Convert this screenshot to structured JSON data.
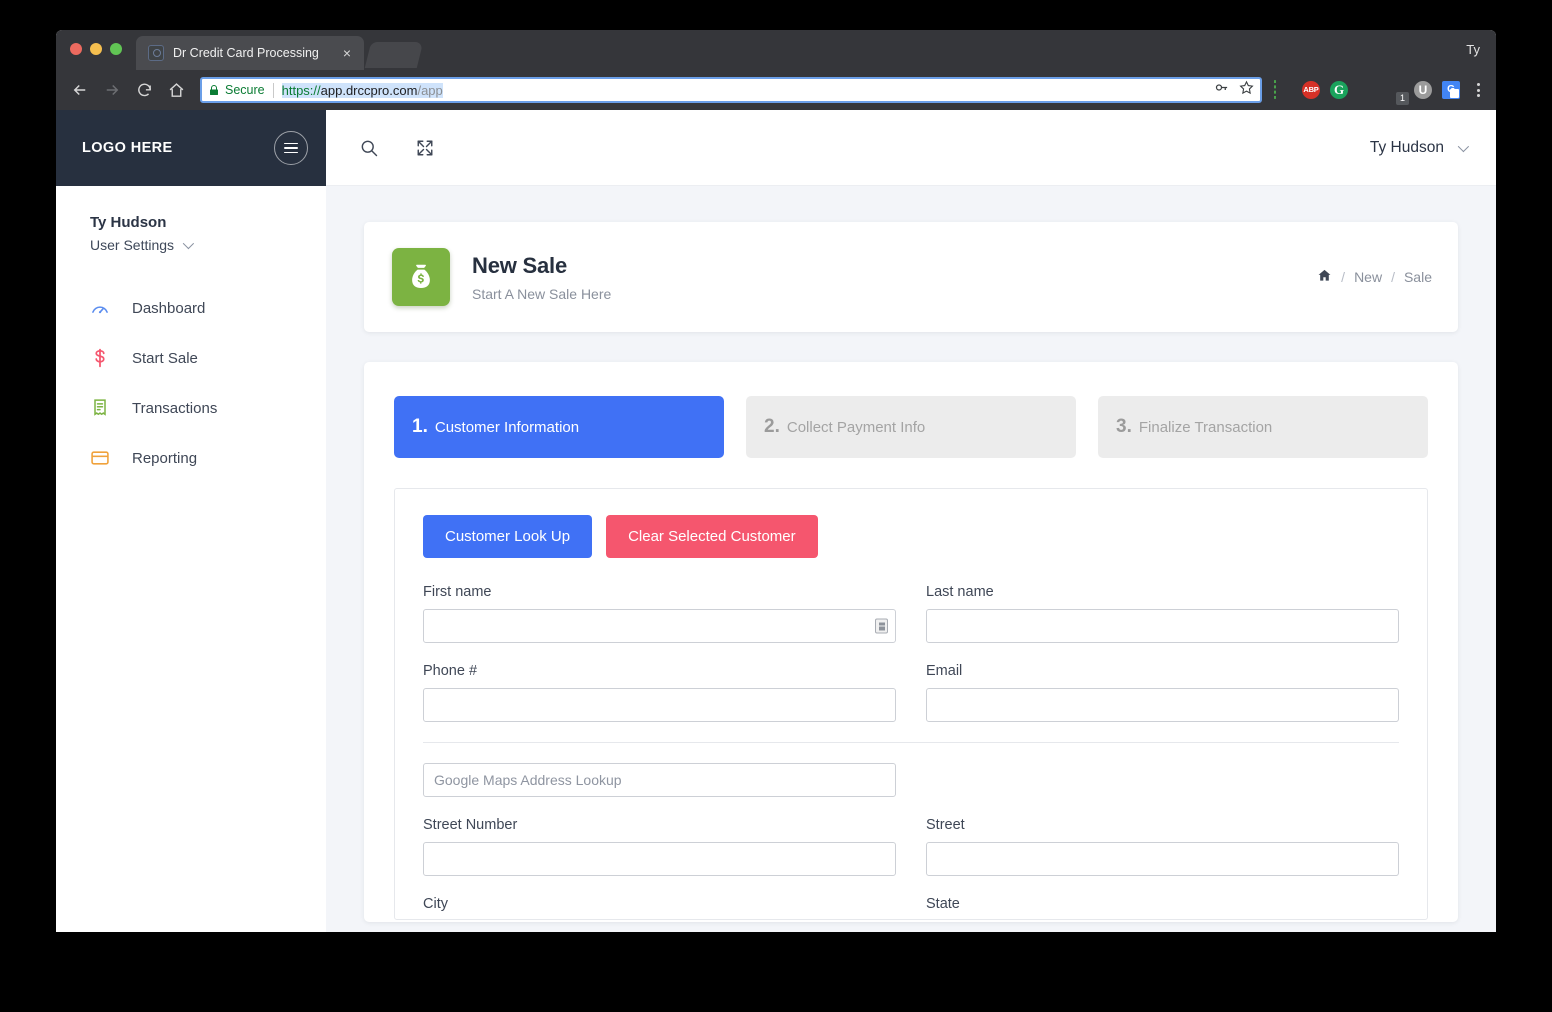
{
  "browser": {
    "tab_title": "Dr Credit Card Processing",
    "tab_close_label": "×",
    "profile_name": "Ty",
    "secure_label": "Secure",
    "url_scheme": "https://",
    "url_host": "app.drccpro.com",
    "url_path": "/app",
    "back_glyph": "←",
    "forward_glyph": "→",
    "reload_glyph": "↻",
    "home_glyph": "⌂",
    "extensions": [
      {
        "name": "cast-icon",
        "label": ""
      },
      {
        "name": "adblock-plus-icon",
        "label": "ABP"
      },
      {
        "name": "grammarly-icon",
        "label": "G"
      },
      {
        "name": "evernote-icon",
        "label": ""
      },
      {
        "name": "honey-icon",
        "label": "",
        "badge": "1"
      },
      {
        "name": "ublock-icon",
        "label": "U"
      },
      {
        "name": "google-translate-icon",
        "label": "G"
      }
    ]
  },
  "sidebar": {
    "logo": "LOGO HERE",
    "user_name": "Ty Hudson",
    "user_settings_label": "User Settings",
    "items": [
      {
        "label": "Dashboard",
        "icon": "dashboard-gauge-icon",
        "color": "#5b8def"
      },
      {
        "label": "Start Sale",
        "icon": "dollar-sign-icon",
        "color": "#f5566e"
      },
      {
        "label": "Transactions",
        "icon": "receipt-icon",
        "color": "#7cb342"
      },
      {
        "label": "Reporting",
        "icon": "credit-card-icon",
        "color": "#f0a23c"
      }
    ]
  },
  "topbar": {
    "search_icon": "search-icon",
    "expand_icon": "expand-arrows-icon",
    "user_name": "Ty Hudson"
  },
  "page_header": {
    "icon": "money-bag-icon",
    "icon_color": "#7cb342",
    "title": "New Sale",
    "subtitle": "Start A New Sale Here",
    "breadcrumb": {
      "home_icon": "home-icon",
      "sep": "/",
      "items": [
        "New",
        "Sale"
      ]
    }
  },
  "steps": [
    {
      "num": "1.",
      "label": "Customer Information",
      "state": "active"
    },
    {
      "num": "2.",
      "label": "Collect Payment Info",
      "state": "idle"
    },
    {
      "num": "3.",
      "label": "Finalize Transaction",
      "state": "idle"
    }
  ],
  "form": {
    "buttons": {
      "lookup": "Customer Look Up",
      "clear": "Clear Selected Customer"
    },
    "fields": {
      "first_name": {
        "label": "First name",
        "value": "",
        "placeholder": ""
      },
      "last_name": {
        "label": "Last name",
        "value": "",
        "placeholder": ""
      },
      "phone": {
        "label": "Phone #",
        "value": "",
        "placeholder": ""
      },
      "email": {
        "label": "Email",
        "value": "",
        "placeholder": ""
      },
      "address_lookup": {
        "label": "",
        "value": "",
        "placeholder": "Google Maps Address Lookup"
      },
      "street_number": {
        "label": "Street Number",
        "value": "",
        "placeholder": ""
      },
      "street": {
        "label": "Street",
        "value": "",
        "placeholder": ""
      },
      "city": {
        "label": "City",
        "value": "",
        "placeholder": ""
      },
      "state": {
        "label": "State",
        "value": "",
        "placeholder": ""
      }
    }
  },
  "colors": {
    "primary_blue": "#4071f5",
    "danger_pink": "#f5566e",
    "brand_green": "#7cb342",
    "sidebar_dark": "#27303f",
    "app_bg": "#f3f5f9"
  }
}
